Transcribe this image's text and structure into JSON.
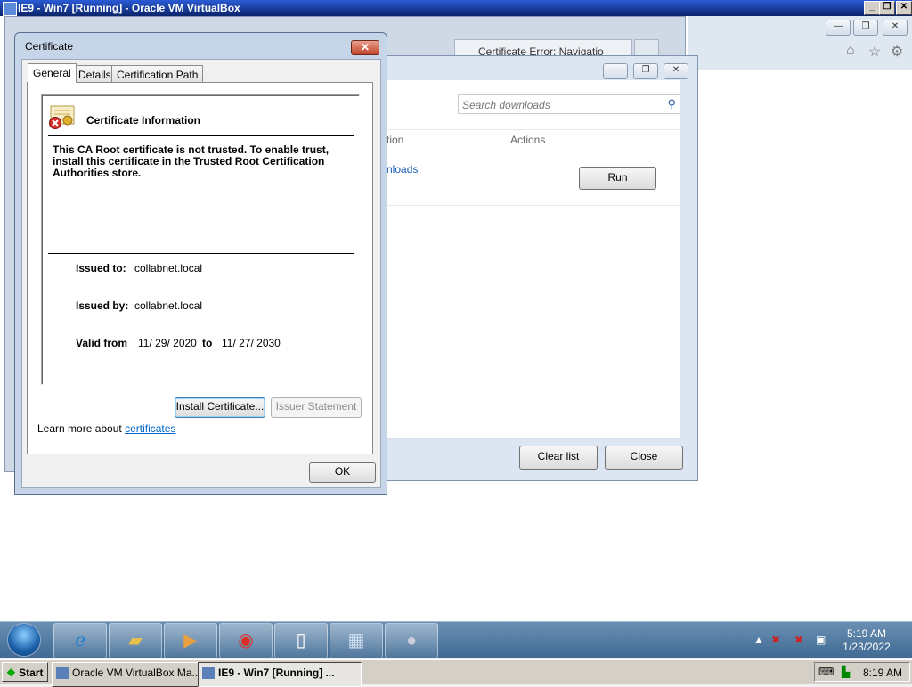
{
  "host": {
    "title": "IE9 - Win7 [Running] - Oracle VM VirtualBox",
    "min": "_",
    "max": "❐",
    "close": "✕",
    "start": "Start",
    "tasks": [
      "Oracle VM VirtualBox Ma...",
      "IE9 - Win7 [Running] ..."
    ],
    "clock": "8:19 AM"
  },
  "ie": {
    "tab_title": "Certificate Error: Navigatio",
    "tools": [
      "⌂",
      "☆",
      "⚙"
    ]
  },
  "downloads": {
    "search_placeholder": "Search downloads",
    "col_name_fragment": "tion",
    "col_actions": "Actions",
    "link_fragment": "nloads",
    "run": "Run",
    "clear": "Clear list",
    "close": "Close"
  },
  "cert": {
    "title": "Certificate",
    "close": "✕",
    "tabs": [
      "General",
      "Details",
      "Certification Path"
    ],
    "info_title": "Certificate Information",
    "warning": "This CA Root certificate is not trusted. To enable trust, install this certificate in the Trusted Root Certification Authorities store.",
    "issued_to_label": "Issued to:",
    "issued_to": "collabnet.local",
    "issued_by_label": "Issued by:",
    "issued_by": "collabnet.local",
    "valid_from_label": "Valid from",
    "valid_from": "11/ 29/ 2020",
    "to_label": "to",
    "valid_to": "11/ 27/ 2030",
    "install": "Install Certificate...",
    "issuer": "Issuer Statement",
    "learn_prefix": "Learn more about",
    "learn_link": "certificates",
    "ok": "OK"
  },
  "taskbar": {
    "time": "5:19 AM",
    "date": "1/23/2022",
    "items": [
      "ie-icon",
      "folder-icon",
      "media-player-icon",
      "chrome-icon",
      "document-icon",
      "network-icon",
      "circle-icon"
    ]
  }
}
